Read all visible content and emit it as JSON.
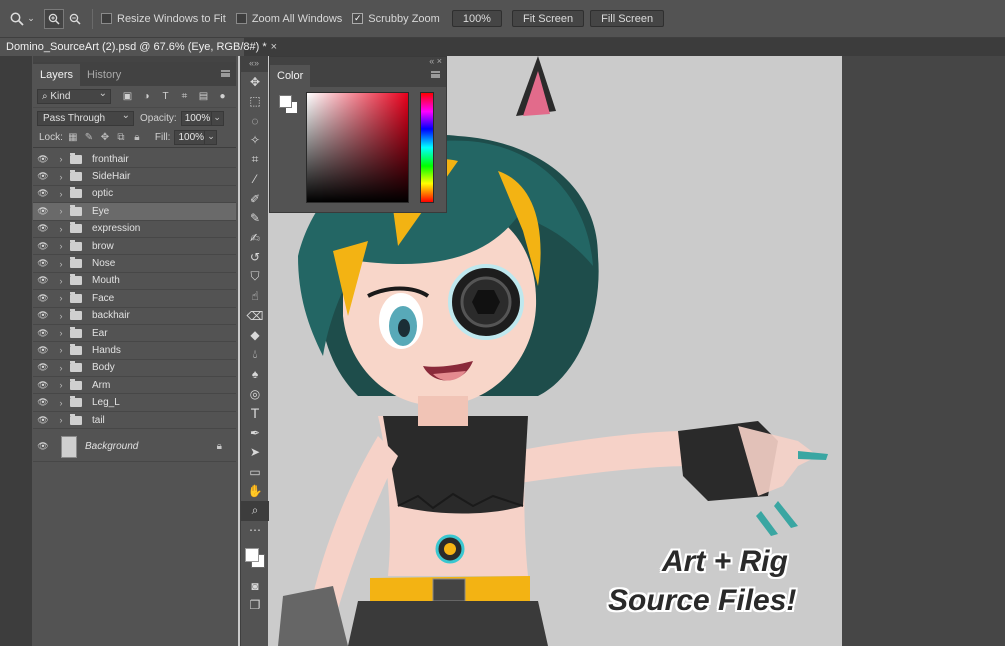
{
  "options_bar": {
    "resize_windows_to_fit": "Resize Windows to Fit",
    "zoom_all_windows": "Zoom All Windows",
    "scrubby_zoom": "Scrubby Zoom",
    "zoom_value": "100%",
    "fit_screen": "Fit Screen",
    "fill_screen": "Fill Screen",
    "icons": [
      "zoom-tool-icon",
      "zoom-in-icon",
      "zoom-out-icon"
    ]
  },
  "document_tab": {
    "title": "Domino_SourceArt (2).psd @ 67.6% (Eye, RGB/8#) *",
    "close": "×"
  },
  "layers_panel": {
    "tabs": [
      "Layers",
      "History"
    ],
    "kind_filter": "Kind",
    "blend_mode": "Pass Through",
    "opacity_label": "Opacity:",
    "opacity_value": "100%",
    "lock_label": "Lock:",
    "fill_label": "Fill:",
    "fill_value": "100%",
    "layers": [
      {
        "name": "fronthair"
      },
      {
        "name": "SideHair"
      },
      {
        "name": "optic"
      },
      {
        "name": "Eye",
        "selected": true
      },
      {
        "name": "expression"
      },
      {
        "name": "brow"
      },
      {
        "name": "Nose"
      },
      {
        "name": "Mouth"
      },
      {
        "name": "Face"
      },
      {
        "name": "backhair"
      },
      {
        "name": "Ear"
      },
      {
        "name": "Hands"
      },
      {
        "name": "Body"
      },
      {
        "name": "Arm"
      },
      {
        "name": "Leg_L"
      },
      {
        "name": "tail"
      }
    ],
    "background_layer": "Background"
  },
  "color_panel": {
    "tab": "Color",
    "foreground": "#ffffff",
    "background": "#ffffff",
    "hue_color": "#e8001c"
  },
  "canvas": {
    "overlay_line1": "Art + Rig",
    "overlay_line2": "Source Files!",
    "background": "#cbcbcb"
  }
}
